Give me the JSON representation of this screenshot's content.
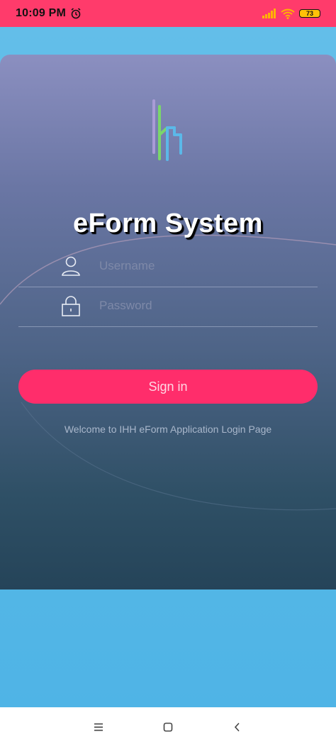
{
  "status_bar": {
    "time": "10:09 PM",
    "battery": "73"
  },
  "app": {
    "title": "eForm System",
    "username_placeholder": "Username",
    "password_placeholder": "Password",
    "signin_label": "Sign in",
    "welcome_text": "Welcome to IHH eForm Application Login Page"
  },
  "colors": {
    "status_bar": "#FF3B6B",
    "accent": "#FF2D6B",
    "background": "#5BB8E8"
  },
  "icons": {
    "alarm": "alarm-icon",
    "signal": "signal-icon",
    "wifi": "wifi-icon",
    "battery": "battery-icon",
    "user": "user-icon",
    "lock": "lock-icon",
    "menu": "menu-icon",
    "home": "home-icon",
    "back": "back-icon"
  }
}
